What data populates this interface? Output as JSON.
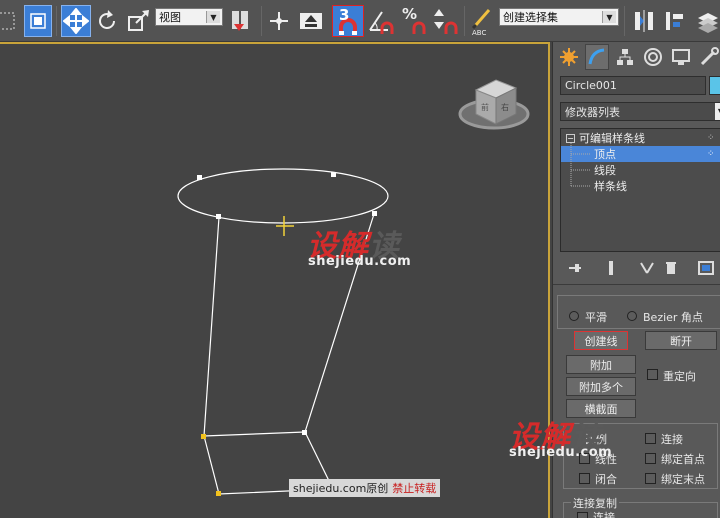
{
  "toolbar": {
    "view_dropdown": "视图",
    "selection_set": "创建选择集",
    "snap_label": "3",
    "percent_label": "%"
  },
  "panel": {
    "object_name": "Circle001",
    "modifier_list": "修改器列表",
    "stack": [
      {
        "label": "可编辑样条线",
        "selected": false
      },
      {
        "label": "顶点",
        "selected": true
      },
      {
        "label": "线段",
        "selected": false
      },
      {
        "label": "样条线",
        "selected": false
      }
    ],
    "geometry": {
      "smooth": "平滑",
      "bezier_corner": "Bezier 角点",
      "create_line": "创建线",
      "break": "断开",
      "attach": "附加",
      "reorient": "重定向",
      "attach_multiple": "附加多个",
      "cross_section": "横截面",
      "ratio_partial": "比例",
      "connect": "连接",
      "line_partial": "线性",
      "bind_first": "绑定首点",
      "closed": "闭合",
      "bind_last": "绑定末点",
      "connect_copy": "连接复制",
      "connect_partial": "连接"
    }
  },
  "watermark": {
    "logo_red": "设解",
    "logo_grey": "读",
    "url": "shejiedu.com",
    "credit": "shejiedu.com原创",
    "credit_red": "禁止转载"
  },
  "colors": {
    "viewport_bg": "#444444",
    "viewport_border": "#c9a43a",
    "selection_blue": "#4a86d8",
    "vertex_yellow": "#f2c21c",
    "watermark_red": "#d52b2b"
  }
}
